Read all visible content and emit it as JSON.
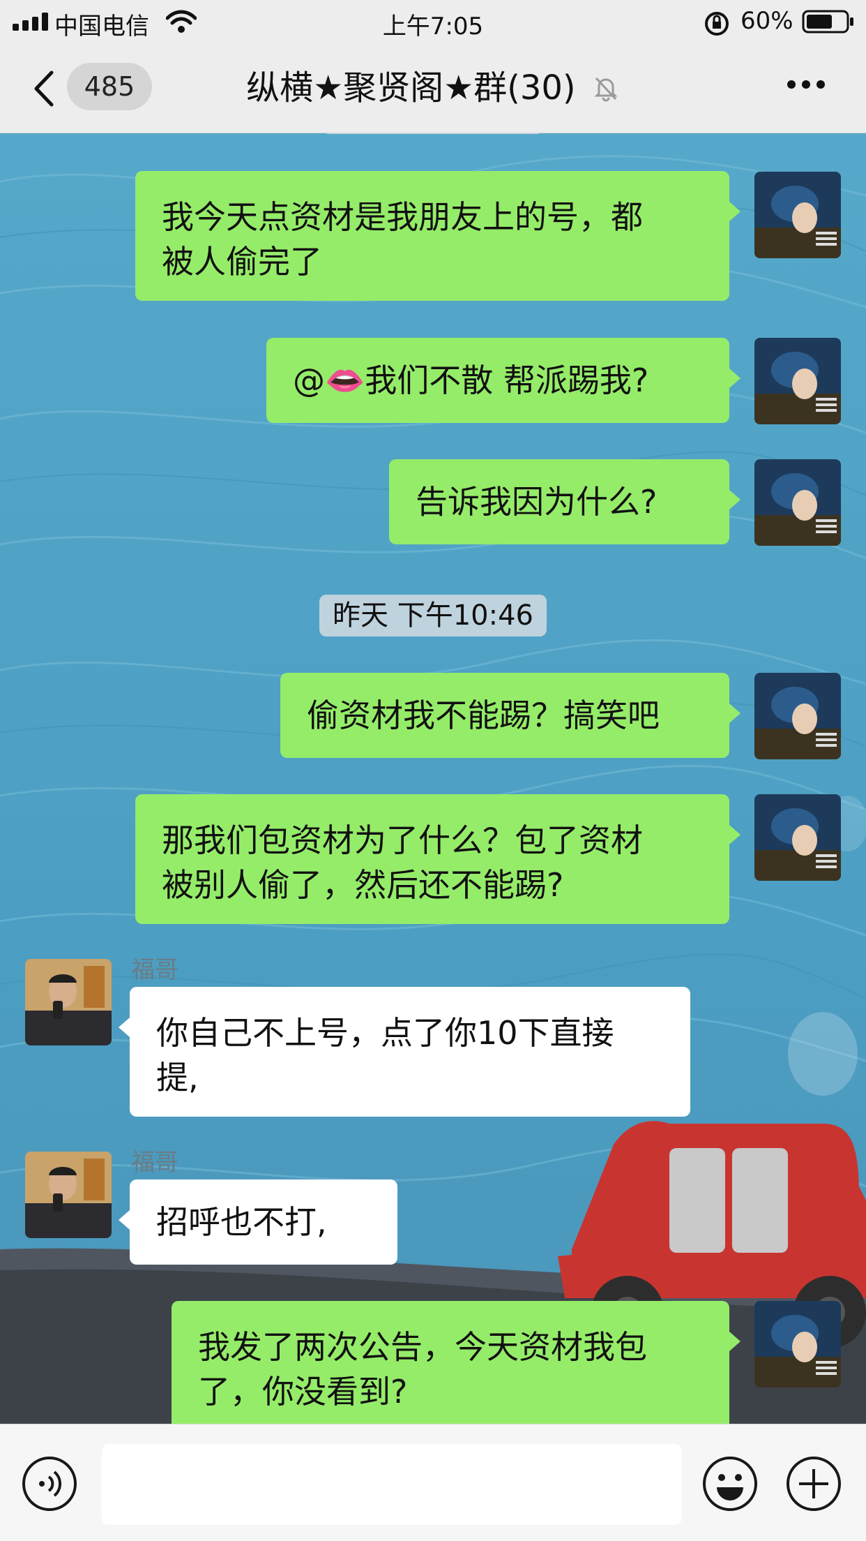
{
  "status_bar": {
    "carrier": "中国电信",
    "time": "上午7:05",
    "battery": "60%",
    "icons": [
      "signal-icon",
      "wifi-icon",
      "rotation-lock-icon",
      "battery-icon"
    ]
  },
  "nav": {
    "unread_count": "485",
    "title": "纵横★聚贤阁★群(30)",
    "icons": [
      "back-chevron-icon",
      "mute-bell-icon",
      "more-icon"
    ]
  },
  "timestamps": {
    "divider": "昨天 下午10:46"
  },
  "messages": [
    {
      "side": "me",
      "text": "我今天点资材是我朋友上的号，都\n被人偷完了"
    },
    {
      "side": "me",
      "text": "@👄我们不散 帮派踢我?"
    },
    {
      "side": "me",
      "text": "告诉我因为什么?"
    },
    {
      "side": "me",
      "text": "偷资材我不能踢？搞笑吧"
    },
    {
      "side": "me",
      "text": "那我们包资材为了什么？包了资材\n被别人偷了，然后还不能踢?"
    },
    {
      "side": "them",
      "sender": "福哥",
      "text": "你自己不上号，点了你10下直接\n提,"
    },
    {
      "side": "them",
      "sender": "福哥",
      "text": "招呼也不打,"
    },
    {
      "side": "me",
      "text": "我发了两次公告，今天资材我包\n了，你没看到?"
    }
  ],
  "input_bar": {
    "placeholder": "",
    "icons": [
      "voice-icon",
      "emoji-icon",
      "plus-icon"
    ]
  },
  "colors": {
    "my_bubble": "#95ec69",
    "their_bubble": "#ffffff",
    "chat_background": "#4fa3c6",
    "bar_background": "#ededed"
  }
}
